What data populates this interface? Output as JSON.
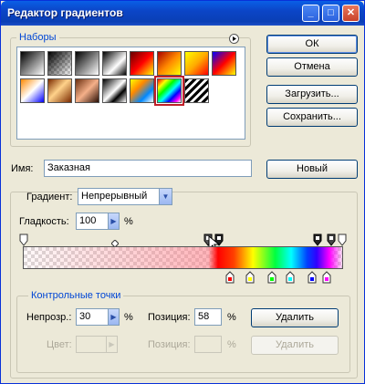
{
  "window": {
    "title": "Редактор градиентов"
  },
  "titlebar_buttons": [
    "_",
    "□",
    "✕"
  ],
  "presets": {
    "label": "Наборы"
  },
  "buttons": {
    "ok": "ОК",
    "cancel": "Отмена",
    "load": "Загрузить...",
    "save": "Сохранить...",
    "new": "Новый",
    "delete_opacity": "Удалить",
    "delete_color": "Удалить"
  },
  "name": {
    "label": "Имя:",
    "value": "Заказная"
  },
  "gradient_type": {
    "label": "Градиент:",
    "value": "Непрерывный"
  },
  "smoothness": {
    "label": "Гладкость:",
    "value": "100",
    "unit": "%"
  },
  "control_points": {
    "label": "Контрольные точки",
    "opacity_label": "Непрозр.:",
    "opacity_value": "30",
    "opacity_unit": "%",
    "position_label": "Позиция:",
    "position_value": "58",
    "position_unit": "%",
    "color_label": "Цвет:",
    "color_position_label": "Позиция:",
    "color_position_unit": "%"
  },
  "colors": {
    "accent": "#0046d5",
    "titlebar": "#0b45c7",
    "selection": "#c0202a"
  },
  "icons": [
    "menu-arrow-icon",
    "dropdown-arrow-icon",
    "spin-arrow-icon",
    "cursor-arrow-icon"
  ]
}
